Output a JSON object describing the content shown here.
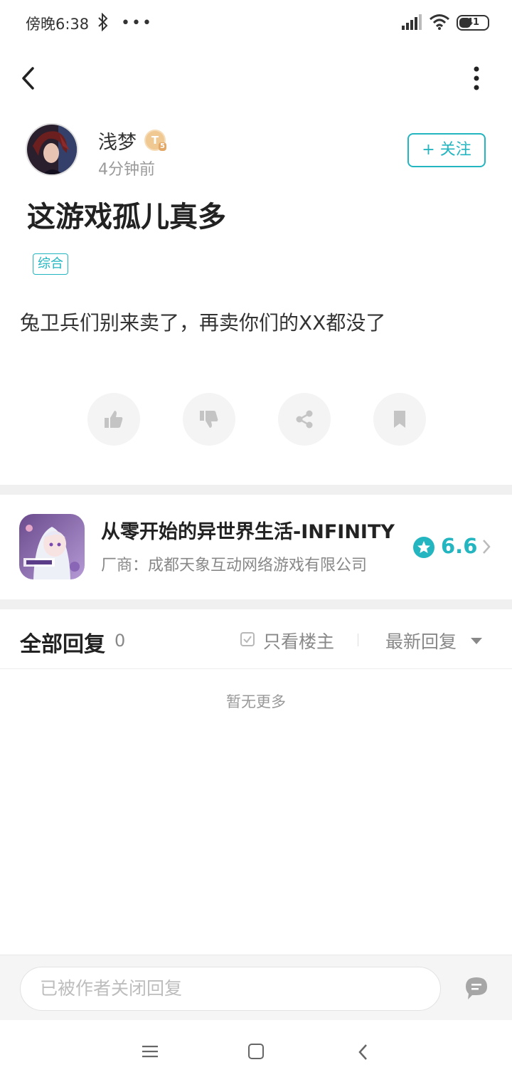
{
  "status_bar": {
    "time": "傍晚6:38",
    "battery": "41",
    "icons": [
      "bluetooth-icon",
      "more-dots-icon",
      "signal-icon",
      "wifi-icon",
      "battery-icon"
    ]
  },
  "toolbar": {
    "back_icon": "chevron-left-icon",
    "more_icon": "vertical-dots-icon"
  },
  "author": {
    "name": "浅梦",
    "level_badge": "T",
    "level_sub": "5",
    "time": "4分钟前",
    "follow_label": "+ 关注"
  },
  "post": {
    "title": "这游戏孤儿真多",
    "tag": "综合",
    "body": "兔卫兵们别来卖了，再卖你们的XX都没了"
  },
  "actions": [
    {
      "name": "like",
      "icon": "thumbs-up-icon"
    },
    {
      "name": "dislike",
      "icon": "thumbs-down-icon"
    },
    {
      "name": "share",
      "icon": "share-icon"
    },
    {
      "name": "bookmark",
      "icon": "bookmark-icon"
    }
  ],
  "game": {
    "name": "从零开始的异世界生活-INFINITY",
    "vendor": "厂商：成都天象互动网络游戏有限公司",
    "rating": "6.6",
    "accent": "#23b5c0"
  },
  "replies": {
    "title": "全部回复",
    "count": "0",
    "op_only_label": "只看楼主",
    "sort_label": "最新回复",
    "empty_text": "暂无更多"
  },
  "bottom": {
    "reply_placeholder": "已被作者关闭回复"
  }
}
